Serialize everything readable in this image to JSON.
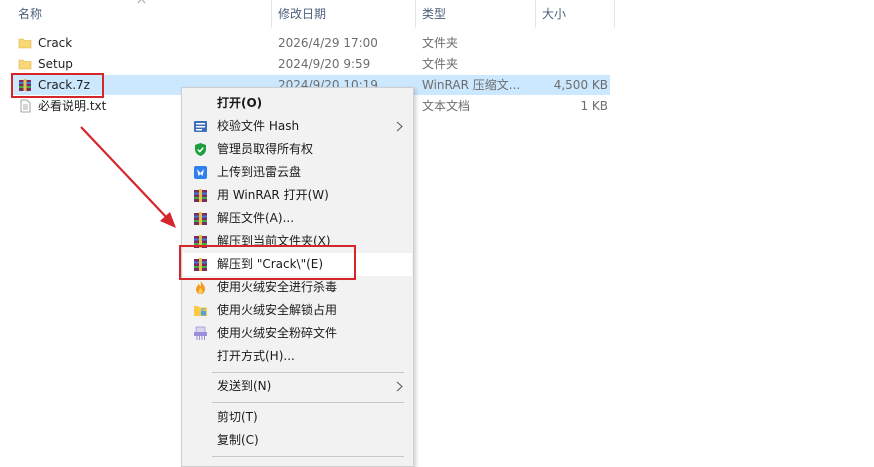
{
  "columns": {
    "name": "名称",
    "modified": "修改日期",
    "type": "类型",
    "size": "大小"
  },
  "files": [
    {
      "name": "Crack",
      "modified": "2026/4/29 17:00",
      "type": "文件夹",
      "size": "",
      "icon": "folder-icon"
    },
    {
      "name": "Setup",
      "modified": "2024/9/20 9:59",
      "type": "文件夹",
      "size": "",
      "icon": "folder-icon"
    },
    {
      "name": "Crack.7z",
      "modified": "2024/9/20 10:19",
      "type": "WinRAR 压缩文...",
      "size": "4,500 KB",
      "icon": "winrar-archive-icon"
    },
    {
      "name": "必看说明.txt",
      "modified": "",
      "type": "文本文档",
      "size": "1 KB",
      "icon": "text-file-icon"
    }
  ],
  "context_menu": {
    "items": [
      {
        "label": "打开(O)",
        "icon": "",
        "bold": true
      },
      {
        "label": "校验文件 Hash",
        "icon": "hash-icon",
        "submenu": true
      },
      {
        "label": "管理员取得所有权",
        "icon": "shield-icon"
      },
      {
        "label": "上传到迅雷云盘",
        "icon": "thunder-cloud-icon"
      },
      {
        "label": "用 WinRAR 打开(W)",
        "icon": "winrar-icon"
      },
      {
        "label": "解压文件(A)...",
        "icon": "winrar-icon"
      },
      {
        "label": "解压到当前文件夹(X)",
        "icon": "winrar-icon"
      },
      {
        "label": "解压到 \"Crack\\\"(E)",
        "icon": "winrar-icon",
        "highlighted": true
      },
      {
        "label": "使用火绒安全进行杀毒",
        "icon": "huorong-flame-icon"
      },
      {
        "label": "使用火绒安全解锁占用",
        "icon": "folder-unlock-icon"
      },
      {
        "label": "使用火绒安全粉碎文件",
        "icon": "shredder-icon"
      },
      {
        "label": "打开方式(H)...",
        "icon": ""
      },
      {
        "label": "发送到(N)",
        "icon": "",
        "submenu": true
      },
      {
        "label": "剪切(T)",
        "icon": ""
      },
      {
        "label": "复制(C)",
        "icon": ""
      }
    ]
  },
  "colors": {
    "selection": "#cce8ff",
    "annotation": "#d4262b",
    "folder": "#f8d775"
  }
}
